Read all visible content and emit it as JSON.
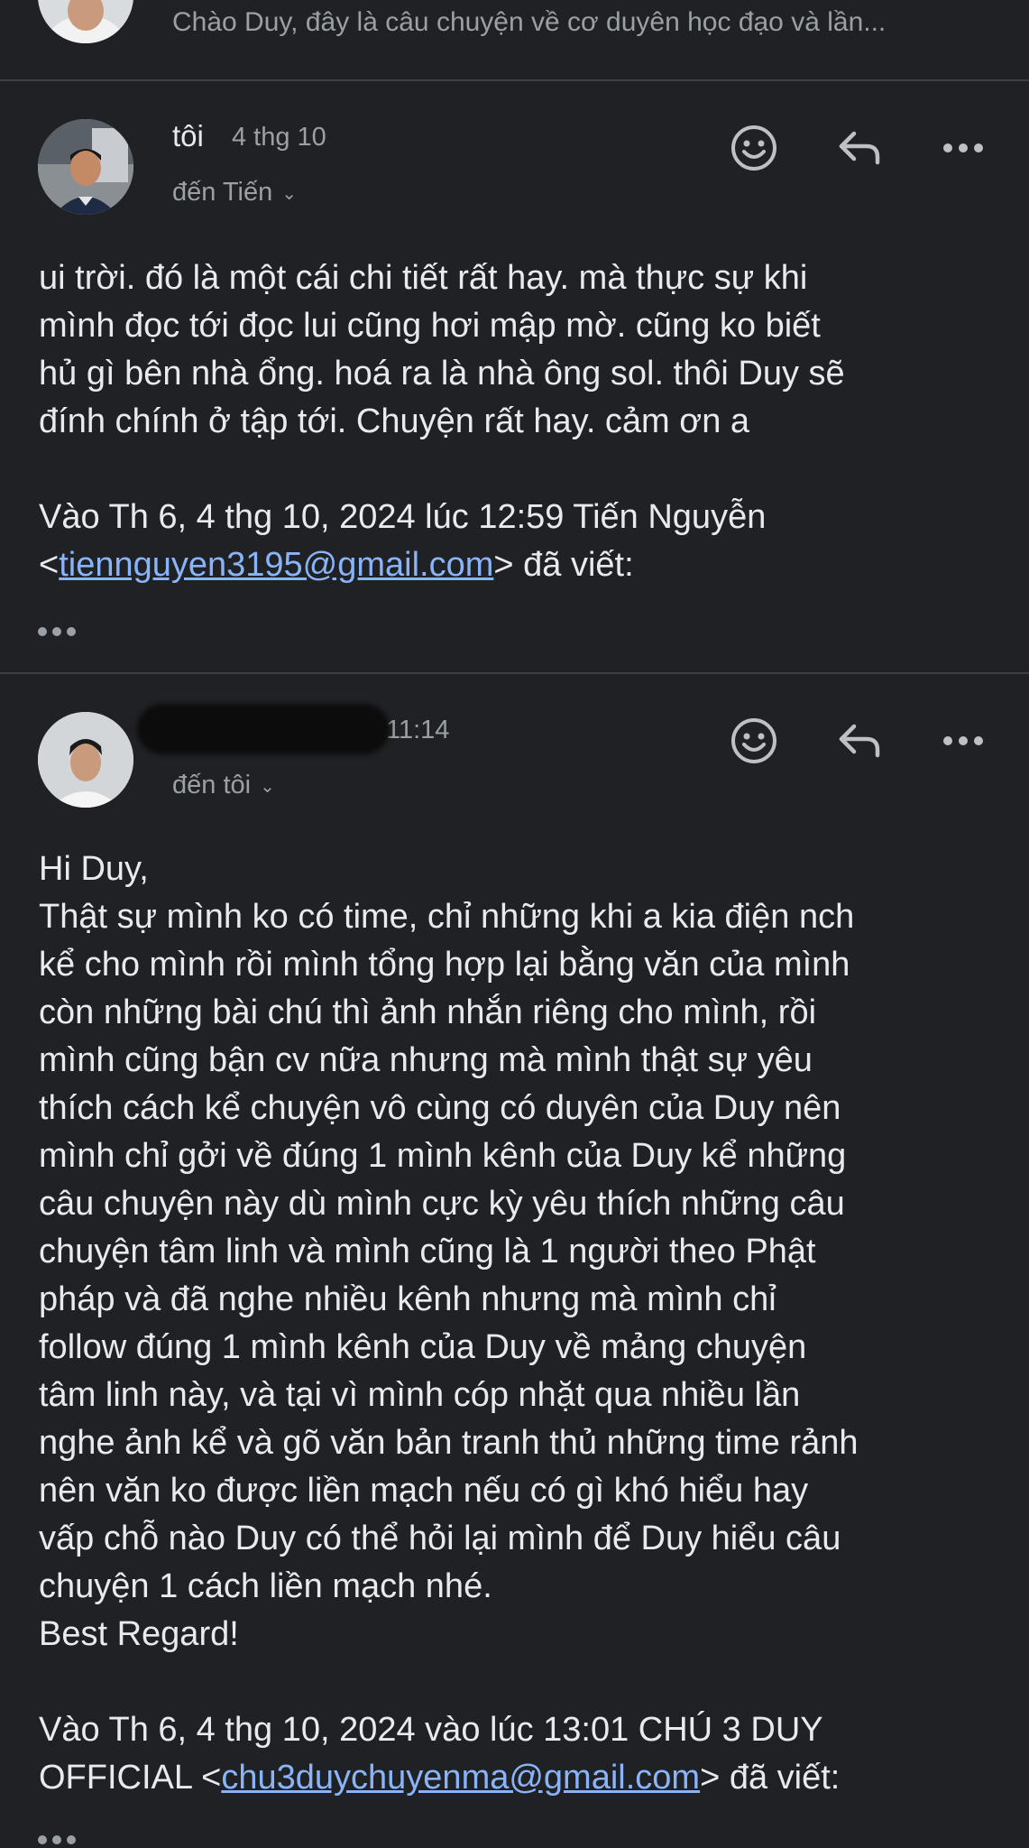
{
  "collapsed": {
    "snippet": "Chào Duy, đây là câu chuyện về cơ duyên học đạo và lần..."
  },
  "message1": {
    "sender": "tôi",
    "date": "4 thg 10",
    "recipient": "đến Tiến",
    "body_lines": [
      "ui trời. đó là một cái chi tiết rất hay. mà thực sự khi",
      "mình đọc tới đọc lui cũng hơi mập mờ. cũng ko biết",
      "hủ gì bên nhà ổng. hoá ra là nhà ông sol. thôi Duy sẽ",
      "đính chính ở tập tới. Chuyện rất hay. cảm ơn a"
    ],
    "quote_line1": "Vào Th 6, 4 thg 10, 2024 lúc 12:59 Tiến Nguyễn",
    "quote_open": "<",
    "quote_email": "tiennguyen3195@gmail.com",
    "quote_close": "> đã viết:"
  },
  "message2": {
    "time": "11:14",
    "recipient": "đến tôi",
    "body_lines": [
      "Hi Duy,",
      "Thật sự mình ko có time, chỉ những khi a kia điện nch",
      "kể cho mình rồi mình tổng hợp lại bằng văn của mình",
      "còn những bài chú thì ảnh nhắn riêng cho mình, rồi",
      "mình cũng bận cv nữa nhưng mà mình thật sự yêu",
      "thích cách kể chuyện vô cùng có duyên của Duy nên",
      "mình chỉ gởi về đúng 1 mình kênh của Duy kể những",
      "câu chuyện này dù mình cực kỳ yêu thích những câu",
      "chuyện tâm linh và mình cũng là 1 người theo Phật",
      "pháp và đã nghe nhiều kênh nhưng mà mình chỉ",
      "follow đúng 1 mình kênh của Duy về mảng chuyện",
      "tâm linh này, và tại vì mình cóp nhặt qua nhiều lần",
      "nghe ảnh kể và gõ văn bản tranh thủ những time rảnh",
      "nên văn ko được liền mạch nếu có gì khó hiểu hay",
      "vấp chỗ nào Duy có thể hỏi lại mình để Duy hiểu câu",
      "chuyện 1 cách liền mạch nhé.",
      "Best Regard!"
    ],
    "quote_line1": "Vào Th 6, 4 thg 10, 2024 vào lúc 13:01 CHÚ 3 DUY",
    "quote_prefix": "OFFICIAL <",
    "quote_email": "chu3duychuyenma@gmail.com",
    "quote_close": "> đã viết:"
  },
  "icons": [
    "emoji-icon",
    "reply-icon",
    "more-icon",
    "chevron-down-icon",
    "show-trimmed-icon"
  ],
  "colors": {
    "background": "#202124",
    "text": "#e8eaed",
    "muted": "#9aa0a6",
    "link": "#8ab4f8",
    "divider": "#3c4043"
  }
}
